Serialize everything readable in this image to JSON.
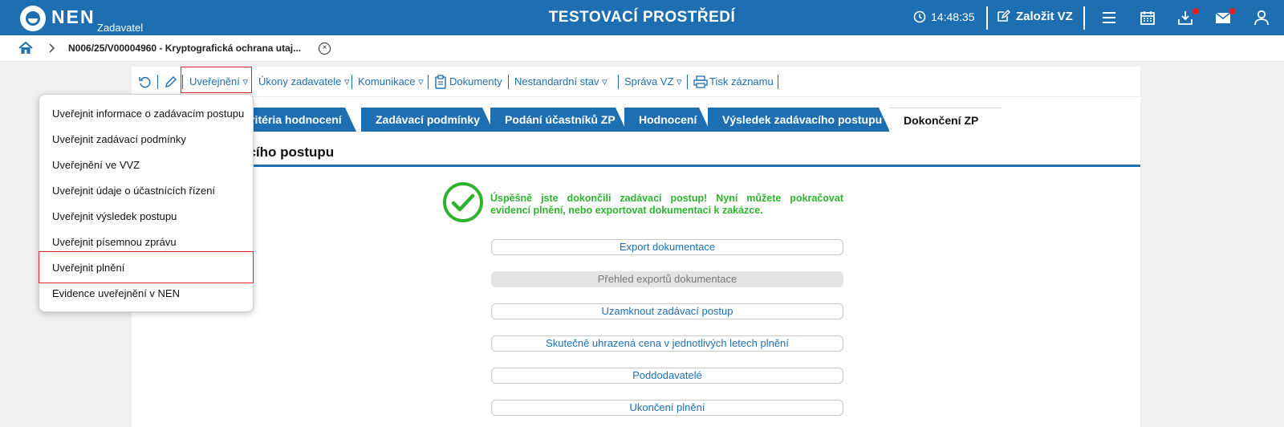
{
  "header": {
    "logo_text": "NEN",
    "logo_sub": "Zadavatel",
    "env_title": "TESTOVACÍ PROSTŘEDÍ",
    "time": "14:48:35",
    "create_label": "Založit VZ",
    "icons": [
      "clock-icon",
      "edit-icon",
      "menu-icon",
      "calendar-icon",
      "download-icon",
      "mail-icon",
      "user-icon"
    ],
    "brand_color": "#1e6fb1",
    "badge_color": "#e02020"
  },
  "breadcrumb": {
    "text": "N006/25/V00004960 - Kryptografická ochrana utaj...",
    "close": "×"
  },
  "toolbar": {
    "items": [
      {
        "label": "Uveřejnění ▿"
      },
      {
        "label": "Úkony zadavatele ▿"
      },
      {
        "label": "Komunikace ▿"
      },
      {
        "label": "Dokumenty"
      },
      {
        "label": "Nestandardní stav ▿"
      },
      {
        "label": "Správa VZ ▿"
      },
      {
        "label": "Tisk záznamu"
      }
    ]
  },
  "tabs": [
    {
      "label": "Kritéria hodnocení"
    },
    {
      "label": "Zadávací podmínky"
    },
    {
      "label": "Podání účastníků ZP"
    },
    {
      "label": "Hodnocení"
    },
    {
      "label": "Výsledek zadávacího postupu"
    },
    {
      "label": "Dokončení ZP"
    }
  ],
  "section_title": "acího postupu",
  "success": {
    "message": "Úspěšně jste dokončili zadávací postup! Nyní můžete pokračovat evidencí plnění, nebo exportovat dokumentaci k zakázce.",
    "color": "#2fb32f"
  },
  "actions": [
    {
      "label": "Export dokumentace",
      "enabled": true
    },
    {
      "label": "Přehled exportů dokumentace",
      "enabled": false
    },
    {
      "label": "Uzamknout zadávací postup",
      "enabled": true
    },
    {
      "label": "Skutečně uhrazená cena v jednotlivých letech plnění",
      "enabled": true
    },
    {
      "label": "Poddodavatelé",
      "enabled": true
    },
    {
      "label": "Ukončení plnění",
      "enabled": true
    }
  ],
  "dropdown": {
    "items": [
      {
        "label": "Uveřejnit informace o zadávacím postupu"
      },
      {
        "label": "Uveřejnit zadávací podmínky"
      },
      {
        "label": "Uveřejnění ve VVZ"
      },
      {
        "label": "Uveřejnit údaje o účastnících řízení"
      },
      {
        "label": "Uveřejnit výsledek postupu"
      },
      {
        "label": "Uveřejnit písemnou zprávu"
      },
      {
        "label": "Uveřejnit plnění"
      },
      {
        "label": "Evidence uveřejnění v NEN"
      }
    ],
    "highlight_color": "#e0262a"
  }
}
